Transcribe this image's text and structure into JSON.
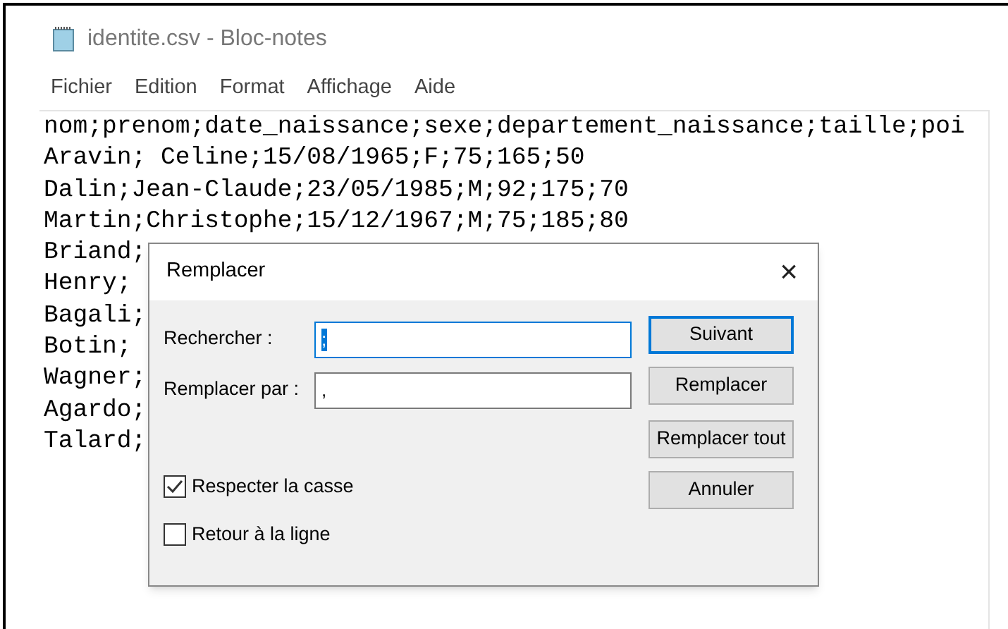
{
  "window": {
    "title": "identite.csv - Bloc-notes"
  },
  "menu": [
    "Fichier",
    "Edition",
    "Format",
    "Affichage",
    "Aide"
  ],
  "lines": [
    "nom;prenom;date_naissance;sexe;departement_naissance;taille;poi",
    "Aravin; Celine;15/08/1965;F;75;165;50",
    "Dalin;Jean-Claude;23/05/1985;M;92;175;70",
    "Martin;Christophe;15/12/1967;M;75;185;80",
    "Briand;",
    "Henry;",
    "Bagali;",
    "Botin;",
    "Wagner;",
    "Agardo;",
    "Talard;"
  ],
  "dialog": {
    "title": "Remplacer",
    "close": "×",
    "fields": [
      {
        "label": "Rechercher :",
        "value": ";",
        "selected": true,
        "focused": true
      },
      {
        "label": "Remplacer par :",
        "value": ",",
        "selected": false,
        "focused": false
      }
    ],
    "buttons": [
      {
        "label": "Suivant",
        "default": true
      },
      {
        "label": "Remplacer",
        "default": false
      },
      {
        "label": "Remplacer tout",
        "default": false
      },
      {
        "label": "Annuler",
        "default": false
      }
    ],
    "checkboxes": [
      {
        "label": "Respecter la casse",
        "checked": true
      },
      {
        "label": "Retour à la ligne",
        "checked": false
      }
    ]
  }
}
